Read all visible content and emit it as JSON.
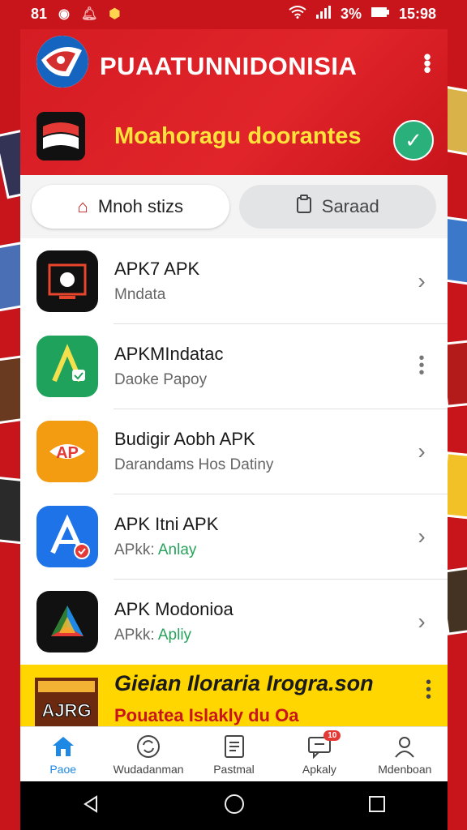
{
  "status_bar": {
    "left_text": "81",
    "battery_percent": "3%",
    "time": "15:98"
  },
  "header": {
    "title": "PUAATUNNIDONISIA",
    "subtitle": "Moahoragu doorantes"
  },
  "tabs": [
    {
      "label": "Mnoh stizs",
      "icon": "home-outline-icon",
      "active": true
    },
    {
      "label": "Saraad",
      "icon": "clipboard-icon",
      "active": false
    }
  ],
  "apps": [
    {
      "title": "APK7 APK",
      "subtitle": "Mndata",
      "subtitle_highlight": "",
      "action": "chevron"
    },
    {
      "title": "APKMIndatac",
      "subtitle": "Daoke Papoy",
      "subtitle_highlight": "",
      "action": "more"
    },
    {
      "title": "Budigir Aobh APK",
      "subtitle": "Darandams Hos Datiny",
      "subtitle_highlight": "",
      "action": "chevron"
    },
    {
      "title": "APK Itni APK",
      "subtitle": "APkk:",
      "subtitle_highlight": "Anlay",
      "action": "chevron"
    },
    {
      "title": "APK Modonioa",
      "subtitle": "APkk:",
      "subtitle_highlight": "Apliy",
      "action": "chevron"
    }
  ],
  "promo": {
    "title": "Gieian Iloraria Irogra.son",
    "subtitle": "Pouatea Islakly du Oa",
    "image_text": "AJRG"
  },
  "bottom_nav": [
    {
      "label": "Paoe",
      "icon": "home-icon",
      "active": true,
      "badge": ""
    },
    {
      "label": "Wudadanman",
      "icon": "refresh-circle-icon",
      "active": false,
      "badge": ""
    },
    {
      "label": "Pastmal",
      "icon": "document-icon",
      "active": false,
      "badge": ""
    },
    {
      "label": "Apkaly",
      "icon": "message-icon",
      "active": false,
      "badge": "10"
    },
    {
      "label": "Mdenboan",
      "icon": "person-icon",
      "active": false,
      "badge": ""
    }
  ],
  "colors": {
    "brand_red": "#c8151b",
    "accent_yellow": "#ffe23a",
    "active_blue": "#1e88e5",
    "fab_green": "#2ab07a"
  }
}
